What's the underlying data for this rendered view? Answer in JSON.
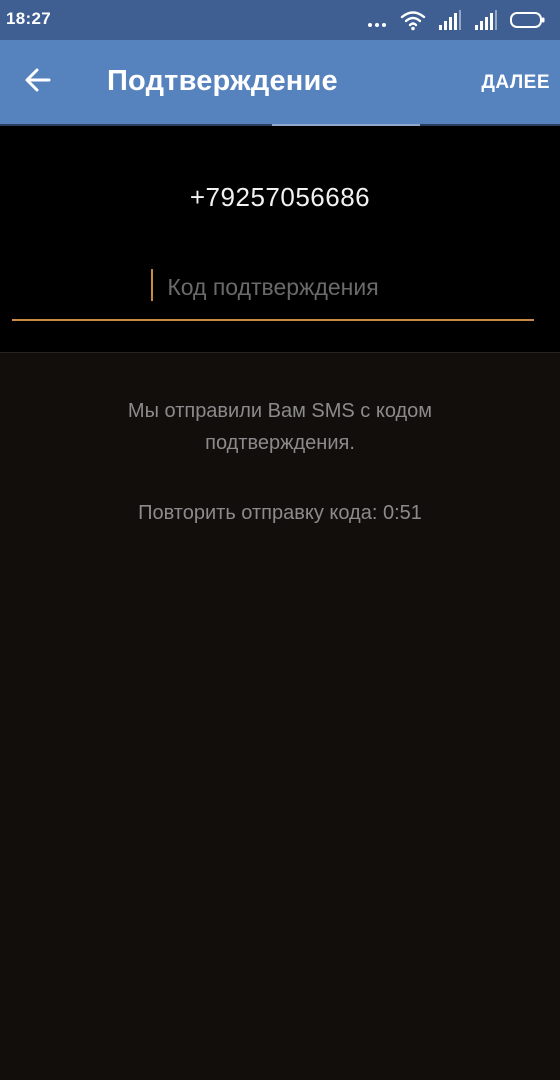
{
  "status_bar": {
    "time": "18:27",
    "icons": [
      "more-dots-icon",
      "wifi-icon",
      "signal-1-icon",
      "signal-2-icon",
      "battery-icon"
    ]
  },
  "app_bar": {
    "back_icon": "arrow-left-icon",
    "title": "Подтверждение",
    "next_label": "ДАЛЕЕ"
  },
  "form": {
    "phone_number": "+79257056686",
    "code_value": "",
    "code_placeholder": "Код подтверждения"
  },
  "info": {
    "sms_message": "Мы отправили Вам SMS с кодом подтверждения.",
    "resend_timer": "Повторить отправку кода: 0:51"
  },
  "colors": {
    "status_bar": "#3f5f92",
    "app_bar": "#5682bd",
    "panel": "#000000",
    "background": "#120e0c",
    "accent": "#c88a45",
    "muted_text": "#8b8b8b"
  }
}
